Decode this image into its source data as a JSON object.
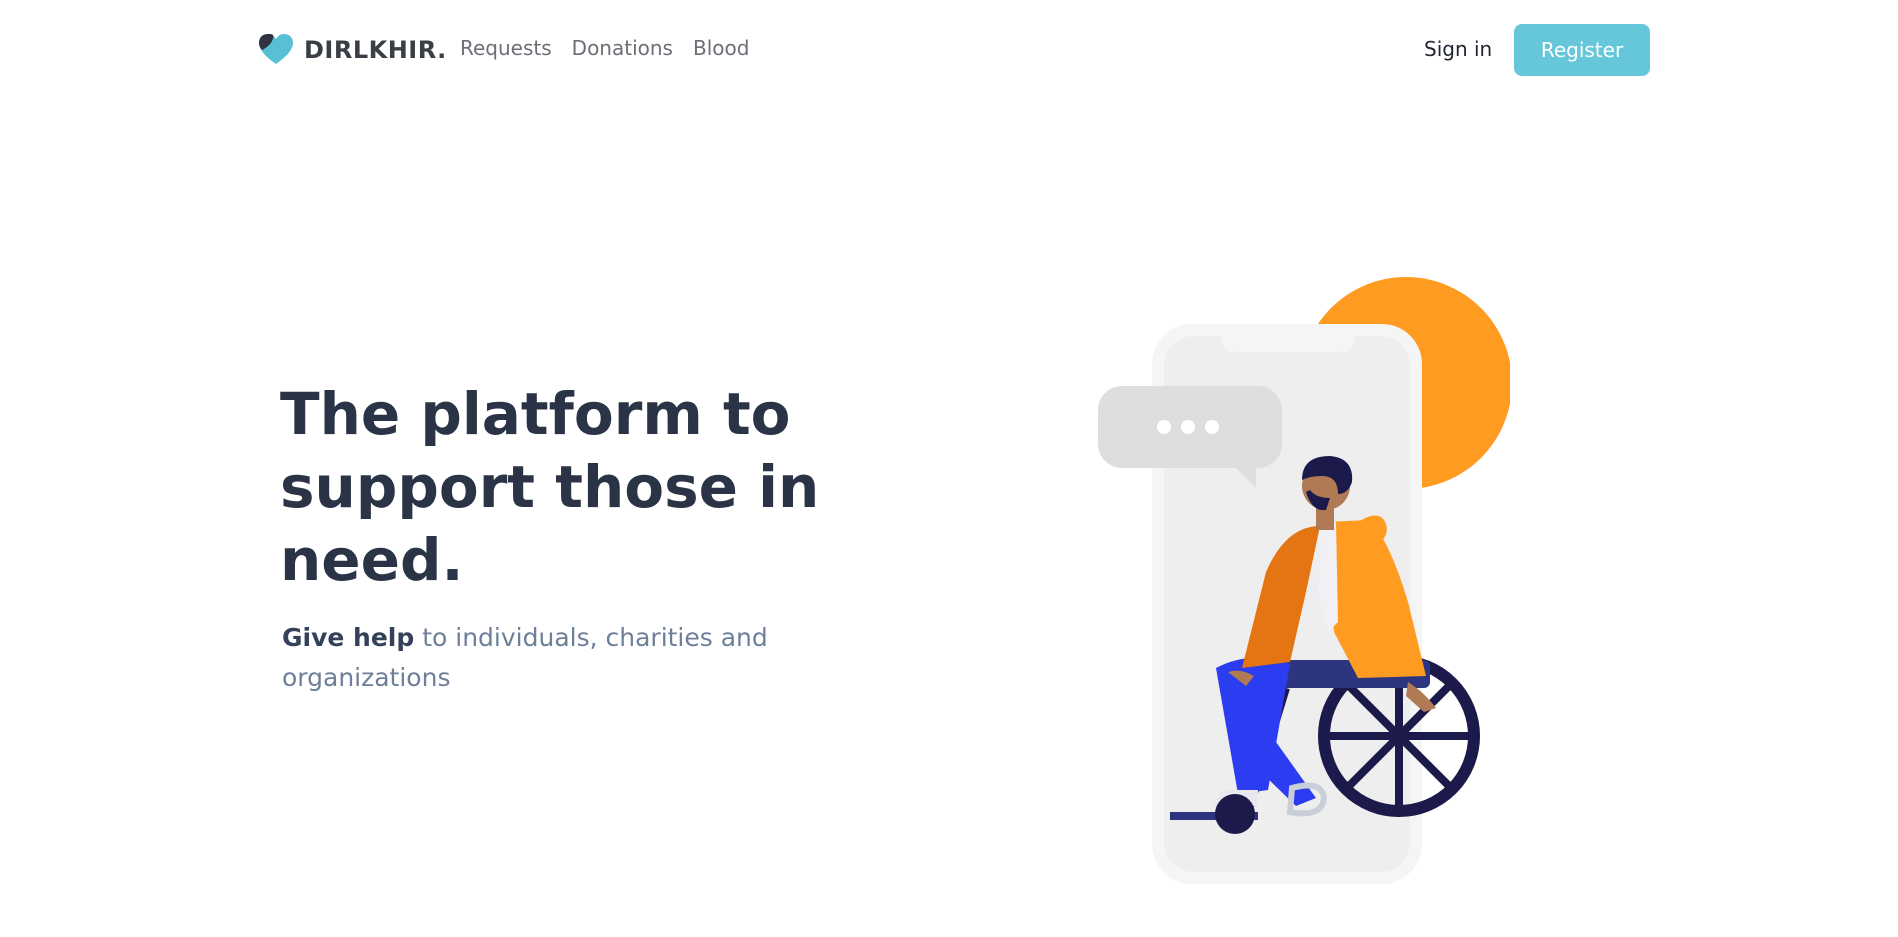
{
  "brand": {
    "name": "DIRLKHIR.",
    "accent_color": "#66c7da",
    "logo_icon": "heart-icon"
  },
  "nav": {
    "links": [
      "Requests",
      "Donations",
      "Blood"
    ],
    "signin_label": "Sign in",
    "register_label": "Register"
  },
  "hero": {
    "title": "The platform to support those in need.",
    "subtitle_bold": "Give help",
    "subtitle_rest": " to individuals, charities and organizations"
  },
  "illustration": {
    "subject": "person-in-wheelchair-illustration",
    "colors": {
      "orange": "#ff9b21",
      "navy": "#1c1a4a",
      "blue": "#2c3cf0",
      "phone": "#f5f5f5"
    }
  }
}
